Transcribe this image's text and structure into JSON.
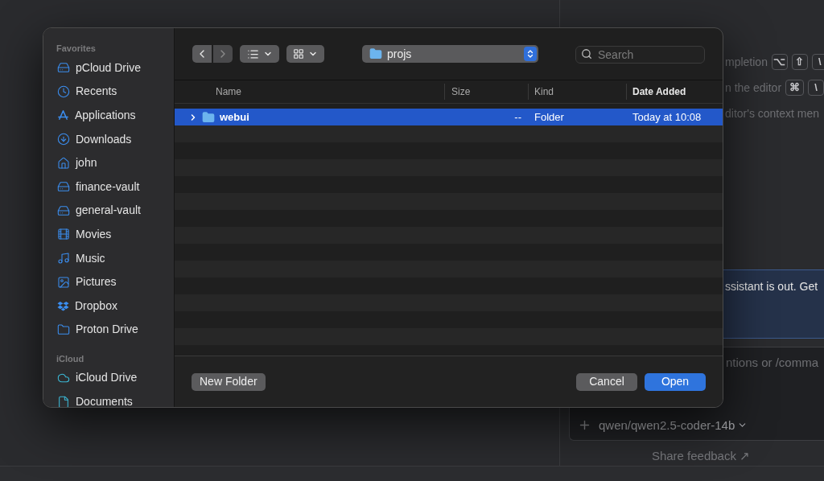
{
  "dialog": {
    "sidebar": {
      "sections": [
        {
          "title": "Favorites",
          "items": [
            {
              "label": "pCloud Drive",
              "selected": false
            },
            {
              "label": "Recents",
              "selected": false
            },
            {
              "label": "Applications",
              "selected": false
            },
            {
              "label": "Downloads",
              "selected": false
            },
            {
              "label": "john",
              "selected": false
            },
            {
              "label": "finance-vault",
              "selected": false
            },
            {
              "label": "general-vault",
              "selected": false
            },
            {
              "label": "Movies",
              "selected": false
            },
            {
              "label": "Music",
              "selected": false
            },
            {
              "label": "Pictures",
              "selected": false
            },
            {
              "label": "Dropbox",
              "selected": false
            },
            {
              "label": "Proton Drive",
              "selected": false
            }
          ]
        },
        {
          "title": "iCloud",
          "items": [
            {
              "label": "iCloud Drive",
              "selected": false
            },
            {
              "label": "Documents",
              "selected": false
            }
          ]
        }
      ]
    },
    "toolbar": {
      "path": "projs",
      "search": {
        "placeholder": "Search"
      }
    },
    "columns": [
      {
        "label": "Name",
        "sorted": false
      },
      {
        "label": "Size",
        "sorted": false
      },
      {
        "label": "Kind",
        "sorted": false
      },
      {
        "label": "Date Added",
        "sorted": true
      }
    ],
    "rows": [
      {
        "name": "webui",
        "size": "--",
        "kind": "Folder",
        "date_added": "Today at 10:08",
        "selected": true,
        "expanded": false
      }
    ],
    "buttons": {
      "new_folder": "New Folder",
      "cancel": "Cancel",
      "open": "Open"
    }
  },
  "background": {
    "hints": [
      {
        "text": "mpletion",
        "keys": [
          "⌥",
          "⇧",
          "\\"
        ]
      },
      {
        "text": "n the editor",
        "keys": [
          "⌘",
          "\\"
        ]
      },
      {
        "text": "ditor's context men"
      }
    ],
    "banner": "ssistant is out. Get",
    "composer": {
      "placeholder": "ntions or /comma",
      "model": "qwen/qwen2.5-coder-14b"
    },
    "feedback_link": "Share feedback ↗"
  }
}
